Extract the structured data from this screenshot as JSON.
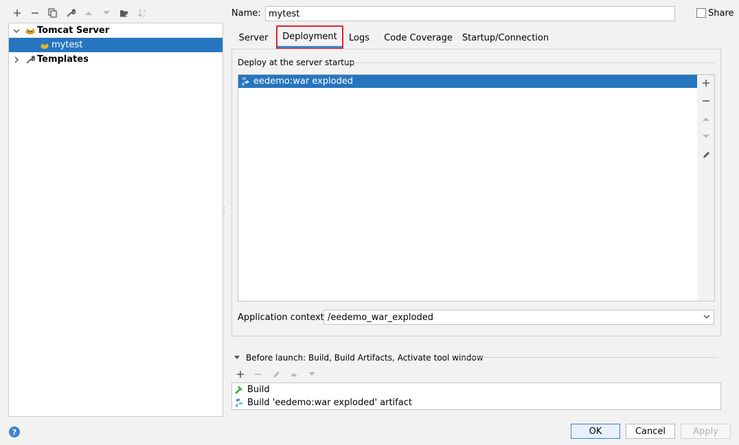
{
  "left_toolbar": {
    "icons": [
      "add-icon",
      "remove-icon",
      "copy-icon",
      "wrench-icon",
      "move-up-icon",
      "move-down-icon",
      "new-folder-icon",
      "sort-icon"
    ]
  },
  "tree": {
    "items": [
      {
        "label": "Tomcat Server",
        "icon": "tomcat-icon",
        "expanded": true
      },
      {
        "label": "mytest",
        "icon": "tomcat-config-icon",
        "selected": true
      },
      {
        "label": "Templates",
        "icon": "wrench-icon",
        "expanded": false
      }
    ]
  },
  "name_row": {
    "label": "Name:",
    "value": "mytest",
    "share_label": "Share",
    "share_checked": false
  },
  "tabs": [
    {
      "label": "Server"
    },
    {
      "label": "Deployment",
      "active": true
    },
    {
      "label": "Logs"
    },
    {
      "label": "Code Coverage"
    },
    {
      "label": "Startup/Connection"
    }
  ],
  "deployment": {
    "section_label": "Deploy at the server startup",
    "artifacts": [
      {
        "label": "eedemo:war exploded",
        "icon": "artifact-icon",
        "selected": true
      }
    ],
    "side_tools": [
      "add-icon",
      "remove-icon",
      "move-up-icon",
      "move-down-icon",
      "edit-icon"
    ],
    "context_label": "Application context:",
    "context_value": "/eedemo_war_exploded"
  },
  "before_launch": {
    "label": "Before launch: Build, Build Artifacts, Activate tool window",
    "tools": [
      "add-icon",
      "remove-icon",
      "edit-icon",
      "move-up-icon",
      "move-down-icon"
    ],
    "items": [
      {
        "label": "Build",
        "icon": "build-hammer-icon"
      },
      {
        "label": "Build 'eedemo:war exploded' artifact",
        "icon": "artifact-icon"
      }
    ]
  },
  "buttons": {
    "ok": "OK",
    "cancel": "Cancel",
    "apply": "Apply"
  },
  "help": "?",
  "colors": {
    "selection": "#2675bf",
    "tab_underline": "#4083c9",
    "highlight_box": "#e0212b"
  }
}
